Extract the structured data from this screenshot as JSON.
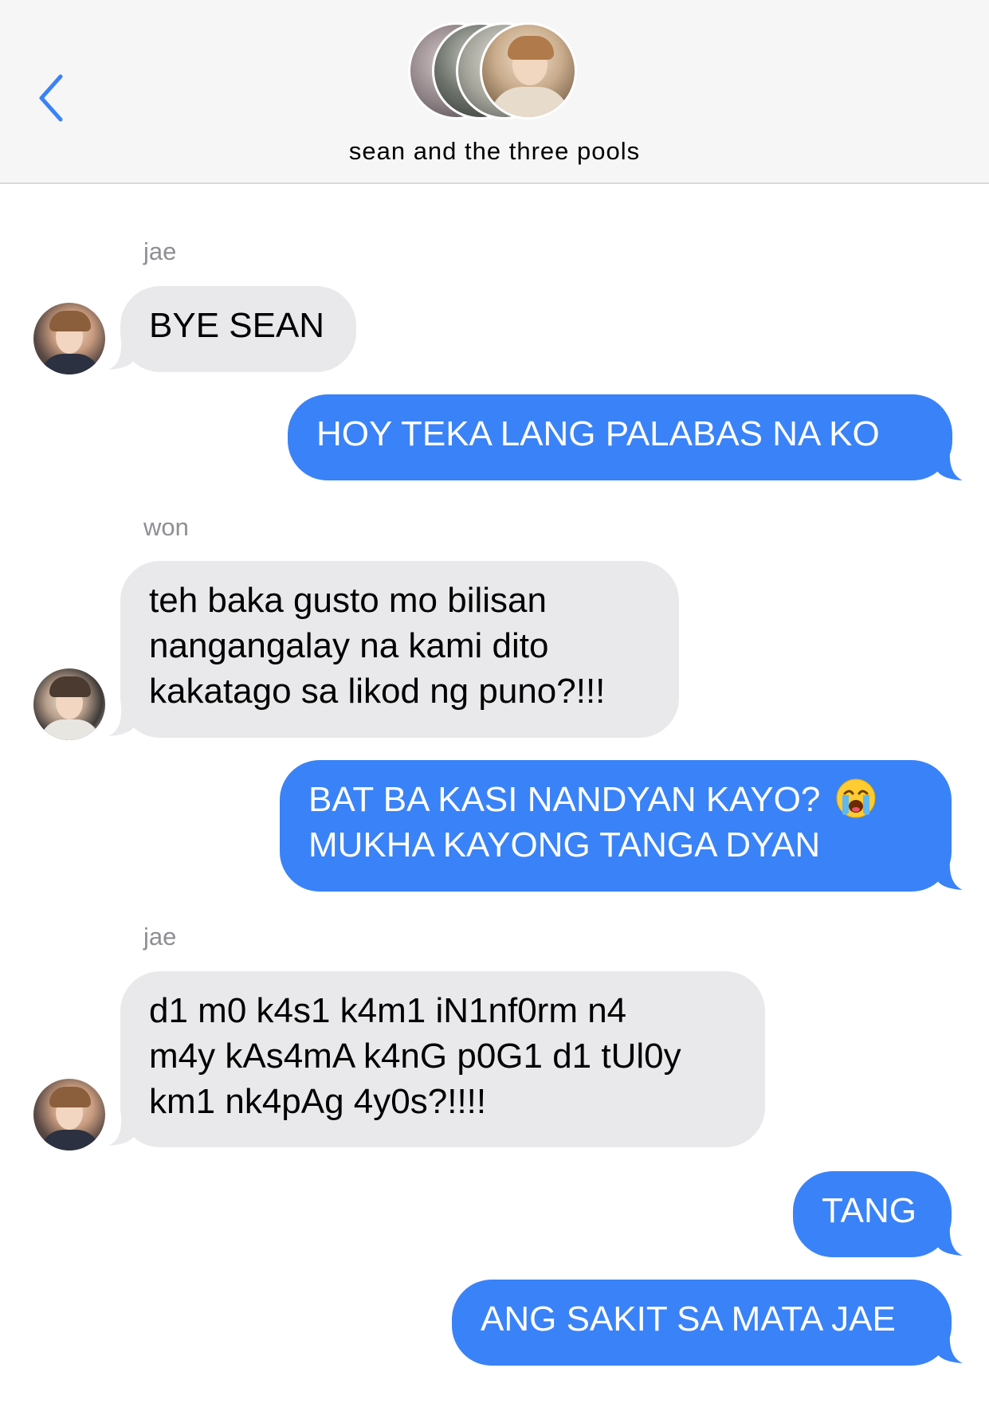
{
  "header": {
    "back_icon": "chevron-left-icon",
    "title": "sean and the three pools",
    "accent_color": "#3a82f7"
  },
  "messages": [
    {
      "sender": "jae",
      "text": "BYE SEAN",
      "direction": "in"
    },
    {
      "text": "HOY TEKA LANG PALABAS NA KO",
      "direction": "out"
    },
    {
      "sender": "won",
      "text": "teh baka gusto mo bilisan\nnangangalay na kami dito\nkakatago sa likod ng puno?!!!",
      "direction": "in"
    },
    {
      "text_line1": "BAT BA KASI NANDYAN KAYO?",
      "emoji": "loudly-crying-face-icon",
      "text_line2": "MUKHA KAYONG TANGA DYAN",
      "direction": "out"
    },
    {
      "sender": "jae",
      "text": "d1 m0 k4s1 k4m1 iN1nf0rm n4\nm4y kAs4mA k4nG p0G1 d1 tUl0y\nkm1 nk4pAg 4y0s?!!!!",
      "direction": "in"
    },
    {
      "text": "TANG",
      "direction": "out"
    },
    {
      "text": "ANG SAKIT SA MATA JAE",
      "direction": "out"
    }
  ],
  "colors": {
    "incoming_bubble": "#e9e9eb",
    "outgoing_bubble": "#3a82f7",
    "sender_name": "#8e8e93"
  }
}
